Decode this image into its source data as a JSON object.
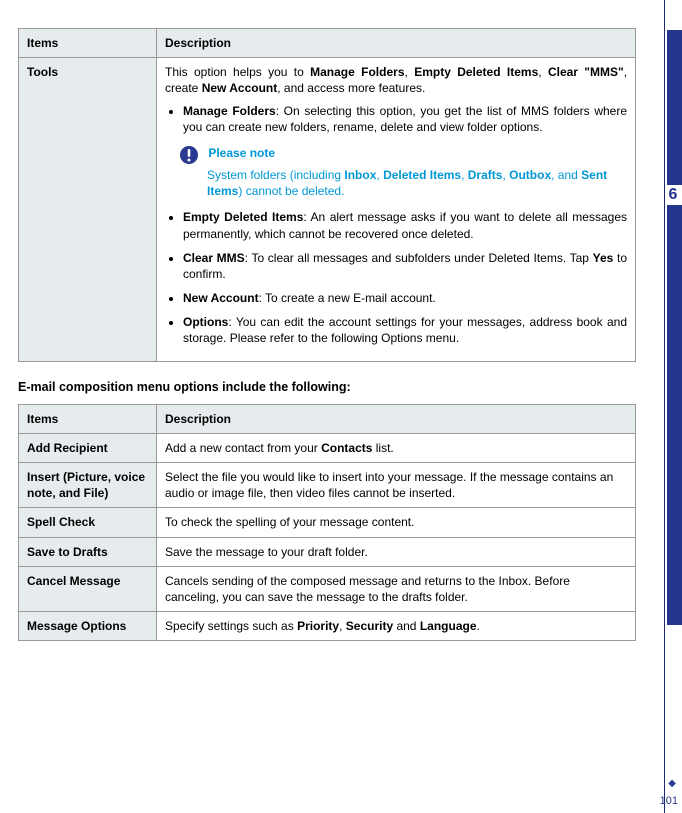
{
  "table1": {
    "headers": {
      "items": "Items",
      "description": "Description"
    },
    "rowLabel": "Tools",
    "intro": {
      "prefix": "This option helps you to ",
      "b1": "Manage Folders",
      "s1": ", ",
      "b2": "Empty Deleted Items",
      "s2": ", ",
      "b3": "Clear \"MMS\"",
      "s3": ", create ",
      "b4": "New Account",
      "s4": ", and access more features."
    },
    "bullet1": {
      "b": "Manage Folders",
      "t": ": On selecting this option, you get the list of MMS folders where you can create new folders, rename, delete and view folder options."
    },
    "note": {
      "head": "Please note",
      "prefix": "System folders (including ",
      "b1": "Inbox",
      "s1": ", ",
      "b2": "Deleted Items",
      "s2": ", ",
      "b3": "Drafts",
      "s3": ", ",
      "b4": "Outbox",
      "s4": ", and ",
      "b5": "Sent Items",
      "s5": ") cannot be deleted."
    },
    "bullet2": {
      "b": "Empty Deleted Items",
      "t": ": An alert message asks if you want to delete all messages permanently, which cannot be recovered once deleted."
    },
    "bullet3": {
      "b": "Clear MMS",
      "t1": ": To clear all messages and subfolders under Deleted Items. Tap ",
      "yes": "Yes",
      "t2": " to confirm."
    },
    "bullet4": {
      "b": "New Account",
      "t": ": To create a new E-mail account."
    },
    "bullet5": {
      "b": "Options",
      "t": ": You can edit the account settings for your messages, address book and storage. Please refer to the following Options menu."
    }
  },
  "heading": "E-mail composition menu options include the following:",
  "table2": {
    "headers": {
      "items": "Items",
      "description": "Description"
    },
    "rows": {
      "addRecipient": {
        "label": "Add Recipient",
        "descPrefix": "Add a new contact from your ",
        "b": "Contacts",
        "descSuffix": " list."
      },
      "insert": {
        "label": "Insert (Picture, voice note, and File)",
        "desc": "Select the file you would like to insert into your message. If the message contains an audio or image file, then video files cannot be inserted."
      },
      "spellCheck": {
        "label": "Spell Check",
        "desc": "To check the spelling of your message content."
      },
      "saveToDrafts": {
        "label": "Save to Drafts",
        "desc": "Save the message to your draft folder."
      },
      "cancel": {
        "label": "Cancel Message",
        "desc": "Cancels sending of the composed message and returns to the Inbox. Before canceling, you can save the message to the drafts folder."
      },
      "messageOptions": {
        "label": "Message Options",
        "descPrefix": "Specify settings such as ",
        "b1": "Priority",
        "s1": ", ",
        "b2": "Security",
        "s2": " and ",
        "b3": "Language",
        "s3": "."
      }
    }
  },
  "side": {
    "chapter": "6",
    "page": "101",
    "dot": "◆"
  }
}
